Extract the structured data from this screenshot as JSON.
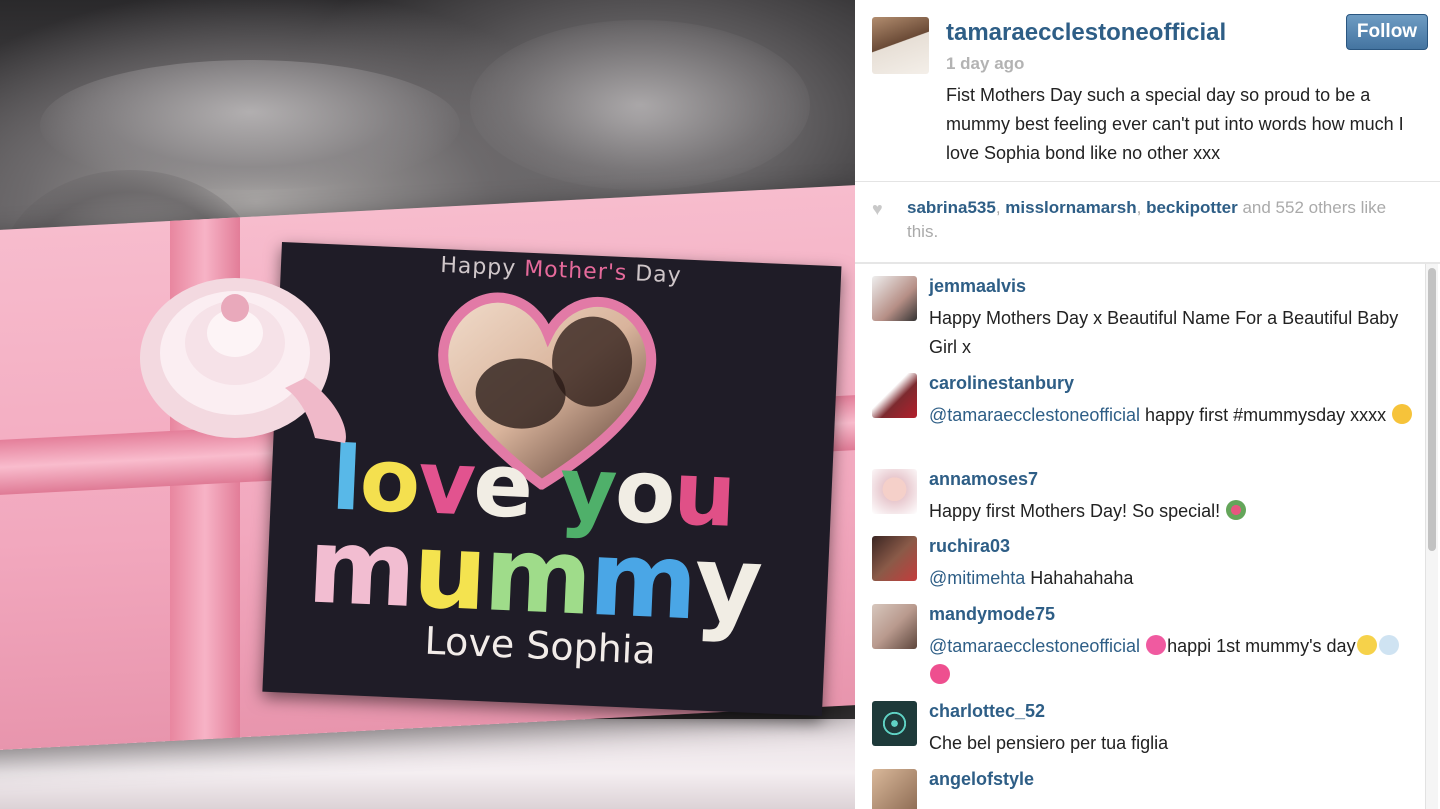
{
  "photo": {
    "card_header": [
      "Happy ",
      "Mother's",
      " Day"
    ],
    "card_love_letters": [
      {
        "ch": "l",
        "color": "#58b8e8"
      },
      {
        "ch": "o",
        "color": "#f4e04f"
      },
      {
        "ch": "v",
        "color": "#e2538f"
      },
      {
        "ch": "e",
        "color": "#f1ede4"
      },
      {
        "ch": " ",
        "color": "#ffffff"
      },
      {
        "ch": "y",
        "color": "#4fb06a"
      },
      {
        "ch": "o",
        "color": "#f1ede4"
      },
      {
        "ch": "u",
        "color": "#e05087"
      }
    ],
    "card_mummy_letters": [
      {
        "ch": "m",
        "color": "#f2bdd1"
      },
      {
        "ch": "u",
        "color": "#f4e34f"
      },
      {
        "ch": "m",
        "color": "#9fdc8a"
      },
      {
        "ch": "m",
        "color": "#4aa6e6"
      },
      {
        "ch": "y",
        "color": "#f1ede4"
      }
    ],
    "card_signature": "Love Sophia"
  },
  "post": {
    "username": "tamaraecclestoneofficial",
    "time_ago": "1 day ago",
    "follow_label": "Follow",
    "caption": "Fist Mothers Day such a special day so proud to be a mummy best feeling ever can't put into words how much I love Sophia bond like no other xxx",
    "likes": {
      "users": [
        "sabrina535",
        "misslornamarsh",
        "beckipotter"
      ],
      "sep1": ", ",
      "sep2": ", ",
      "rest": " and 552 others like this."
    }
  },
  "comments": [
    {
      "user": "jemmaalvis",
      "mention": "",
      "text": "Happy Mothers Day x Beautiful Name For a Beautiful Baby Girl x",
      "emoji": [],
      "avatar": "#c9a7a0"
    },
    {
      "user": "carolinestanbury",
      "mention": "@tamaraecclestoneofficial",
      "text": " happy first #mummysday xxxx ",
      "emoji": [
        "kiss-emoji"
      ],
      "avatar": "#7d2a2f"
    },
    {
      "user": "annamoses7",
      "mention": "",
      "text": "Happy first Mothers Day! So special! ",
      "emoji": [
        "bouquet-emoji"
      ],
      "avatar": "#e8c9cf"
    },
    {
      "user": "ruchira03",
      "mention": "@mitimehta",
      "text": " Hahahahaha",
      "emoji": [],
      "avatar": "#8a5a48"
    },
    {
      "user": "mandymode75",
      "mention": "@tamaraecclestoneofficial",
      "text": "happi 1st mummy's day",
      "emoji": [
        "sparkle-emoji",
        "baby-bottle-emoji",
        "gift-heart-emoji"
      ],
      "pre_emoji": "pink-heart-emoji",
      "avatar": "#b99a8e"
    },
    {
      "user": "charlottec_52",
      "mention": "",
      "text": "Che bel pensiero per tua figlia",
      "emoji": [],
      "avatar": "#1e3a3a"
    },
    {
      "user": "angelofstyle",
      "mention": "",
      "text": "",
      "emoji": [],
      "avatar": "#8c6a52"
    }
  ],
  "colors": {
    "link_blue": "#2e5e86",
    "follow_button": "#4f7fab",
    "muted": "#b3b3b3"
  }
}
